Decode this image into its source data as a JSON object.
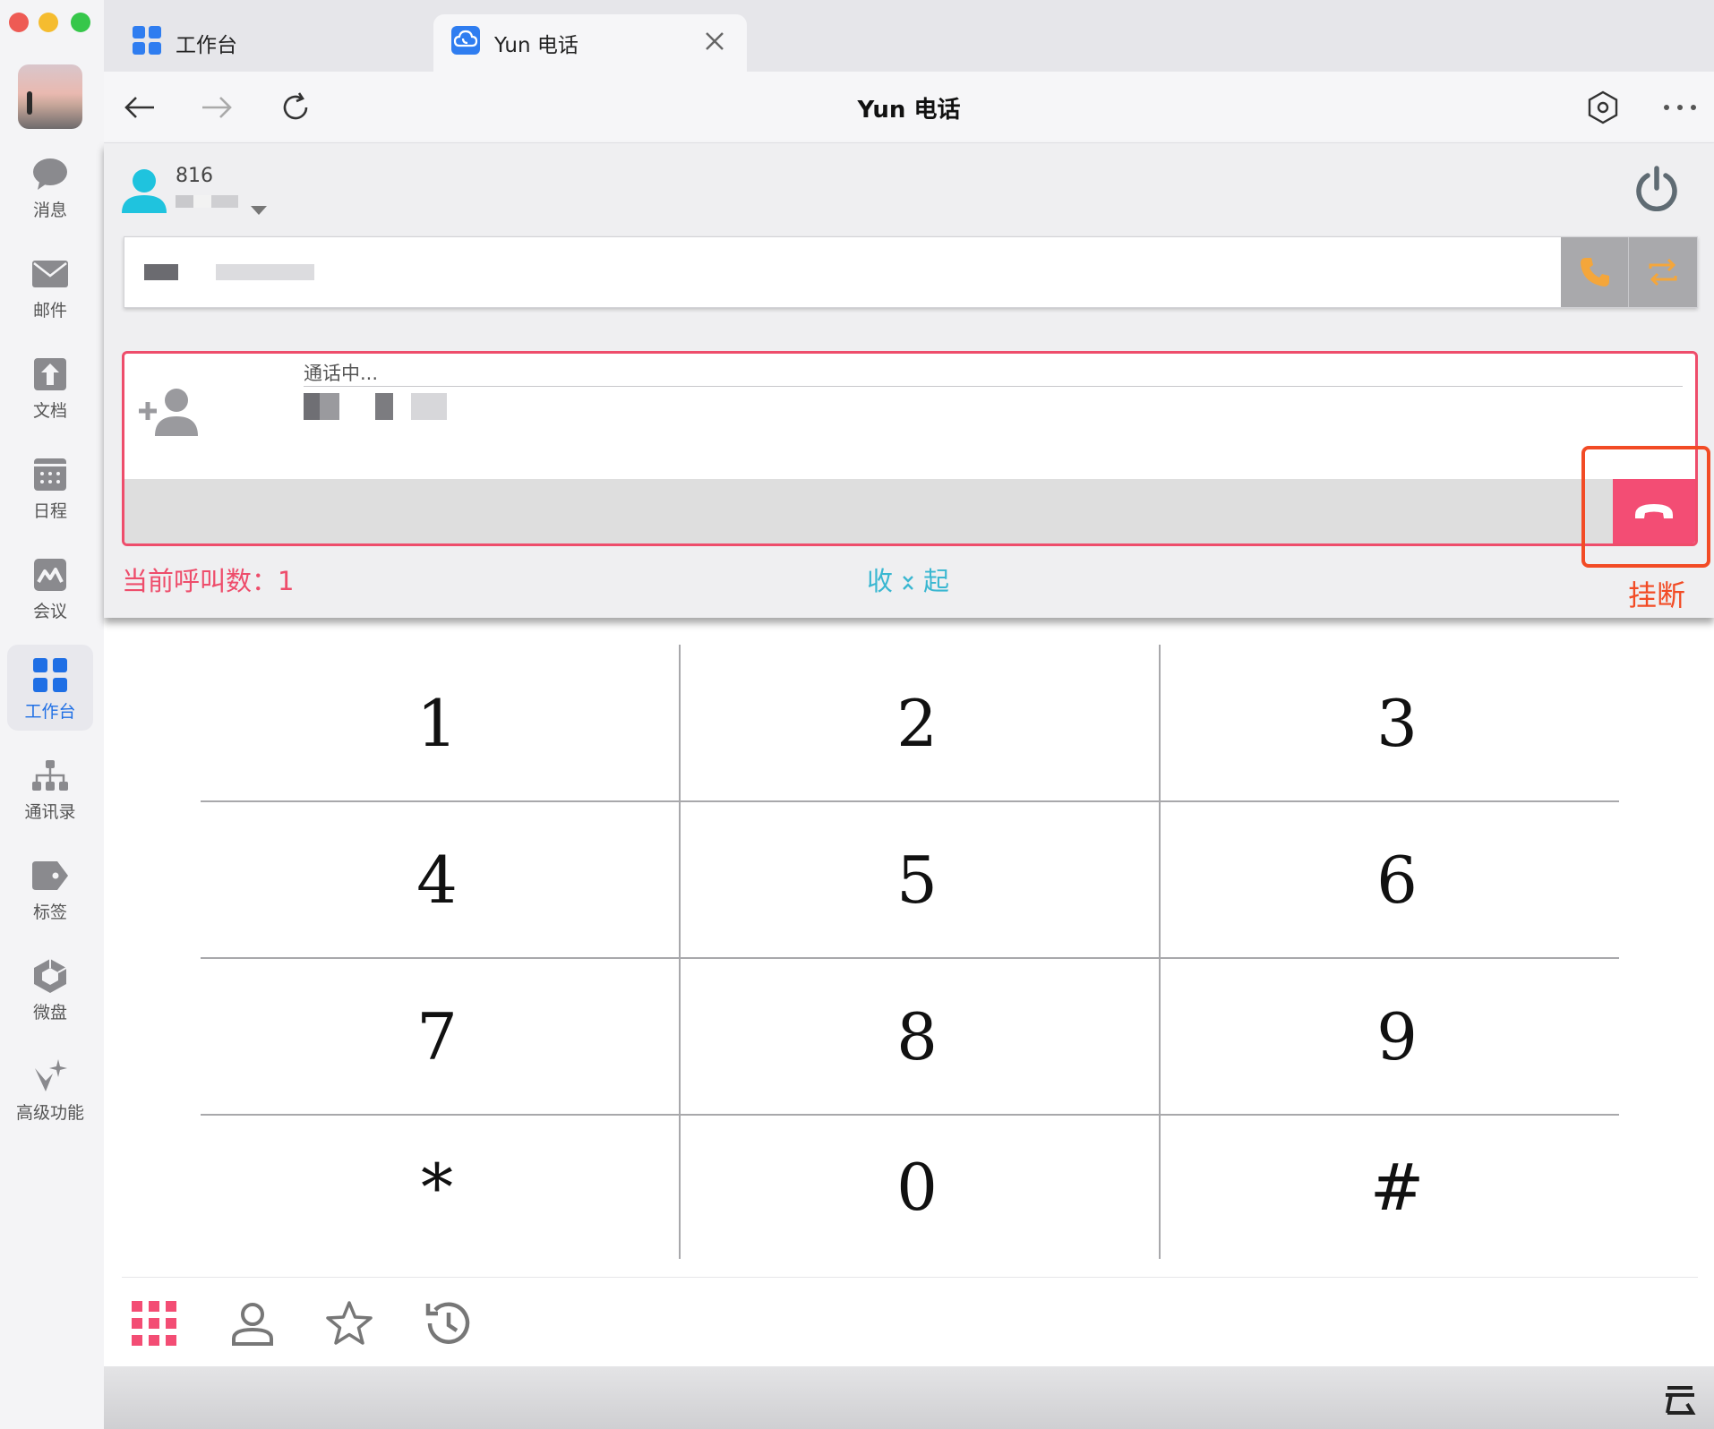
{
  "app": {
    "window_title": "Yun 电话",
    "colors": {
      "accent_blue": "#1f6fe5",
      "hangup_red": "#f34d74",
      "call_border": "#ee4d6b",
      "annotation": "#f24b25",
      "teal_link": "#3ab7d1",
      "call_icon_orange": "#f4a63b"
    }
  },
  "dock": {
    "items": [
      {
        "label": "消息",
        "icon": "chat-bubble-icon"
      },
      {
        "label": "邮件",
        "icon": "envelope-icon"
      },
      {
        "label": "文档",
        "icon": "document-icon"
      },
      {
        "label": "日程",
        "icon": "calendar-icon"
      },
      {
        "label": "会议",
        "icon": "meeting-icon"
      },
      {
        "label": "工作台",
        "icon": "workbench-grid-icon",
        "active": true
      },
      {
        "label": "通讯录",
        "icon": "org-chart-icon"
      },
      {
        "label": "标签",
        "icon": "tag-icon"
      },
      {
        "label": "微盘",
        "icon": "cloud-drive-icon"
      },
      {
        "label": "高级功能",
        "icon": "sparkle-icon"
      }
    ]
  },
  "tabs": [
    {
      "label": "工作台",
      "icon": "workbench-grid-icon"
    },
    {
      "label": "Yun 电话",
      "icon": "cloud-phone-icon",
      "active": true
    }
  ],
  "nav": {
    "title": "Yun 电话"
  },
  "phone": {
    "extension": "816",
    "dial_placeholder": "",
    "call_status": "通话中...",
    "call_count_label": "当前呼叫数：1",
    "collapse_label_left": "收",
    "collapse_label_right": "起",
    "hangup_annotation": "挂断"
  },
  "keypad": {
    "keys": [
      "1",
      "2",
      "3",
      "4",
      "5",
      "6",
      "7",
      "8",
      "9",
      "*",
      "0",
      "#"
    ]
  },
  "bottom_toolbar": {
    "items": [
      "dialpad-icon",
      "contacts-icon",
      "favorites-star-icon",
      "history-icon"
    ]
  }
}
